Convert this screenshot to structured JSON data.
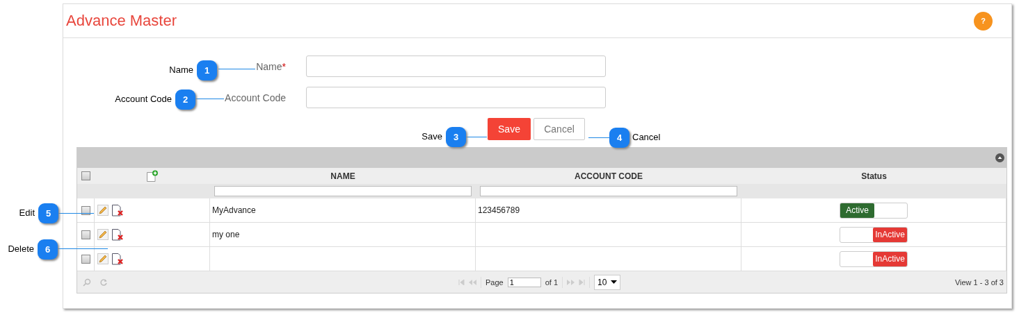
{
  "page": {
    "title": "Advance Master",
    "help": "?"
  },
  "form": {
    "required_mark": "*",
    "fields": [
      {
        "label": "Name",
        "required": true
      },
      {
        "label": "Account Code",
        "required": false
      }
    ],
    "buttons": [
      {
        "label": "Save",
        "kind": "primary"
      },
      {
        "label": "Cancel",
        "kind": "secondary"
      }
    ]
  },
  "table": {
    "all_checked": false,
    "columns": [
      "NAME",
      "ACCOUNT CODE",
      "Status"
    ],
    "rows": [
      {
        "checked": false,
        "name": "MyAdvance",
        "account_code": "123456789",
        "active": true,
        "status": "Active"
      },
      {
        "checked": false,
        "name": "my one",
        "active": false,
        "status": "InActive"
      },
      {
        "checked": false,
        "active": false,
        "status": "InActive"
      }
    ],
    "pager": {
      "page_label": "Page",
      "page": "1",
      "of": "of 1",
      "page_size": "10",
      "view": "View 1 - 3 of 3"
    }
  },
  "callouts": [
    {
      "number": "1",
      "text": "Name"
    },
    {
      "number": "2",
      "text": "Account Code"
    },
    {
      "number": "3",
      "text": "Save"
    },
    {
      "number": "4",
      "text": "Cancel"
    },
    {
      "number": "5",
      "text": "Edit"
    },
    {
      "number": "6",
      "text": "Delete"
    }
  ]
}
